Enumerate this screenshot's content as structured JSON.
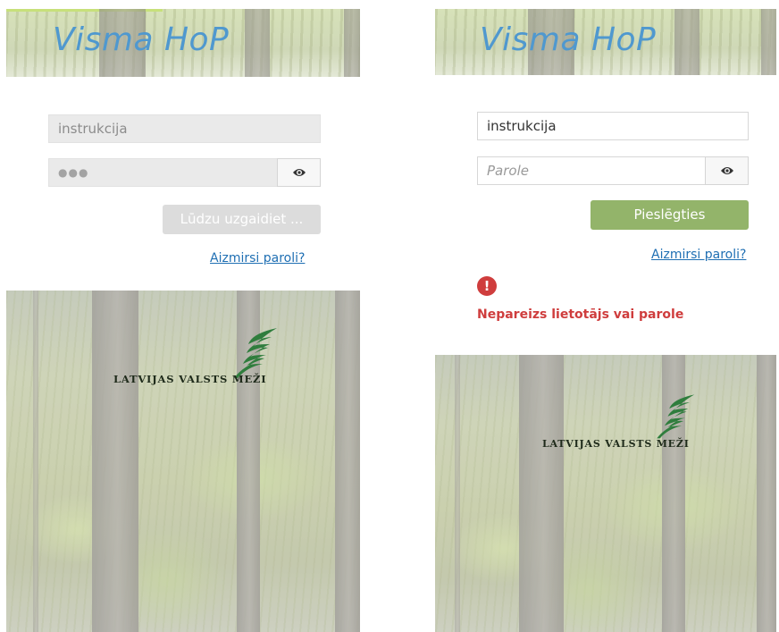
{
  "app": {
    "title": "Visma HoP",
    "org_logo_text": "LATVIJAS VALSTS MEŽI"
  },
  "colors": {
    "brand_blue": "#4f98cf",
    "login_green": "#93b46a",
    "error_red": "#cf3d3d",
    "link_blue": "#1f6fb3"
  },
  "left_panel": {
    "username_value": "instrukcija",
    "password_masked": "●●●",
    "show_password_icon": "eye-icon",
    "wait_button_label": "Lūdzu uzgaidiet ...",
    "forgot_password_link": "Aizmirsi paroli?"
  },
  "right_panel": {
    "username_value": "instrukcija",
    "password_placeholder": "Parole",
    "show_password_icon": "eye-icon",
    "login_button_label": "Pieslēgties",
    "forgot_password_link": "Aizmirsi paroli?",
    "error_icon": "exclamation-icon",
    "error_icon_glyph": "!",
    "error_message": "Nepareizs lietotājs vai parole"
  }
}
